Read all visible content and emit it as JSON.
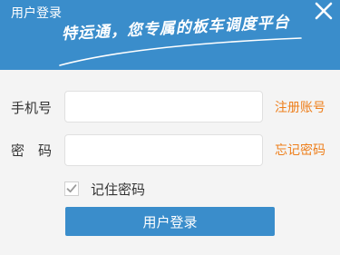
{
  "header": {
    "title": "用户登录",
    "slogan": "特运通，您专属的板车调度平台",
    "background_color": "#3a8dcb",
    "close_icon": "close-icon"
  },
  "form": {
    "phone": {
      "label": "手机号",
      "value": "",
      "placeholder": ""
    },
    "password": {
      "label": "密　码",
      "value": "",
      "placeholder": ""
    },
    "register_link": "注册账号",
    "forgot_link": "忘记密码",
    "remember": {
      "label": "记住密码",
      "checked": true
    },
    "login_button": "用户登录",
    "link_color": "#ee7f1c"
  }
}
